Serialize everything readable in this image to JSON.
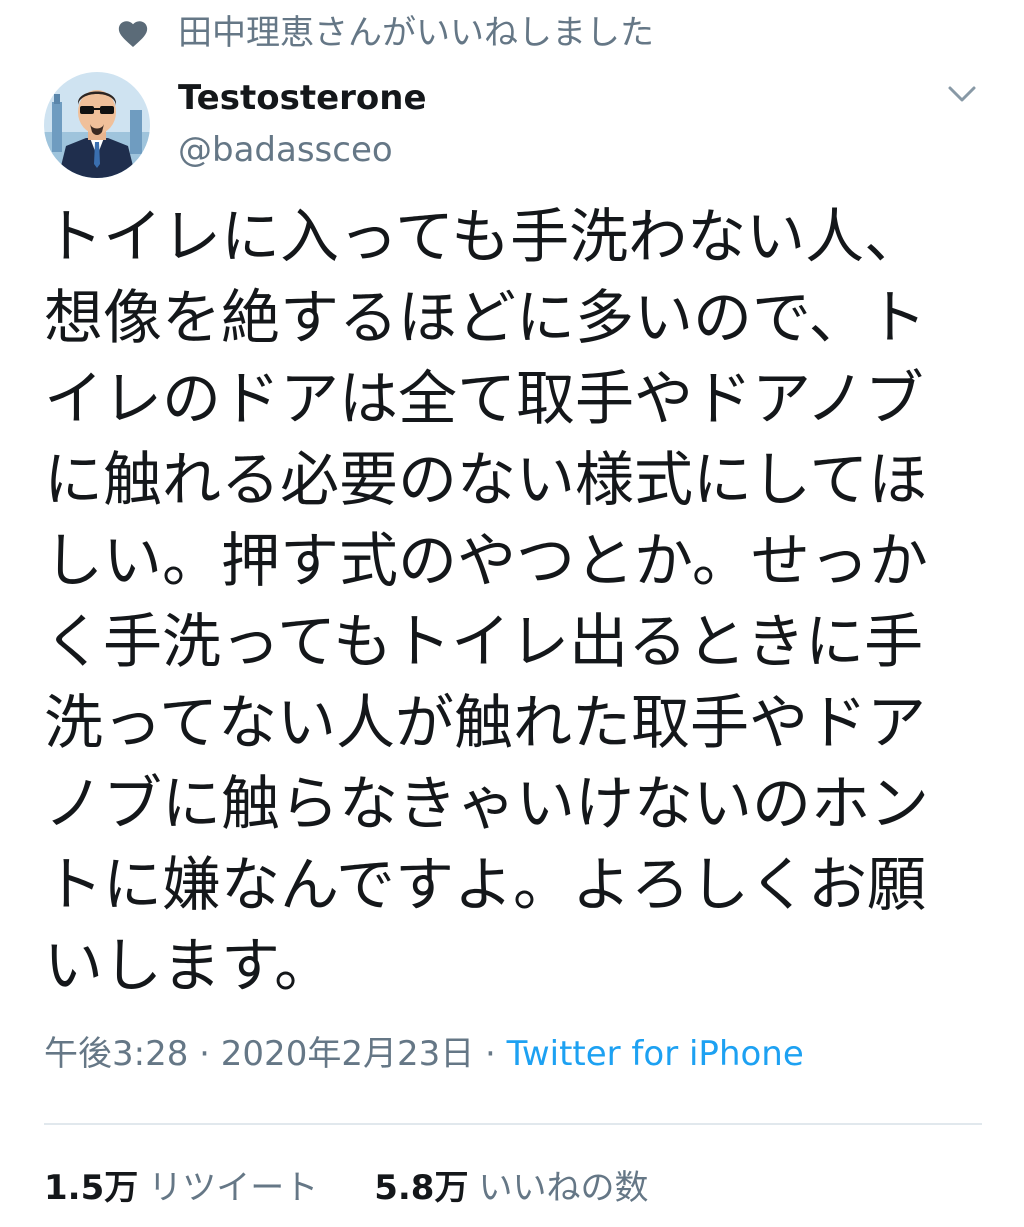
{
  "social_context": {
    "icon": "heart-icon",
    "text": "田中理恵さんがいいねしました"
  },
  "author": {
    "display_name": "Testosterone",
    "username": "@badassceo",
    "avatar": "avatar-illustration"
  },
  "tweet": {
    "text": "トイレに入っても手洗わない人、\n想像を絶するほどに多いので、ト\nイレのドアは全て取手やドアノブ\nに触れる必要のない様式にしてほ\nしい。押す式のやつとか。せっか\nく手洗ってもトイレ出るときに手\n洗ってない人が触れた取手やドア\nノブに触らなきゃいけないのホン\nトに嫌なんですよ。よろしくお願\nいします。"
  },
  "meta": {
    "time": "午後3:28",
    "separator1": " · ",
    "date": "2020年2月23日",
    "separator2": " · ",
    "source": "Twitter for iPhone"
  },
  "stats": {
    "retweets_count": "1.5万",
    "retweets_label": "リツイート",
    "likes_count": "5.8万",
    "likes_label": "いいねの数"
  },
  "colors": {
    "primary_text": "#14171a",
    "secondary_text": "#657786",
    "link": "#1da1f2",
    "divider": "#e1e8ed"
  }
}
